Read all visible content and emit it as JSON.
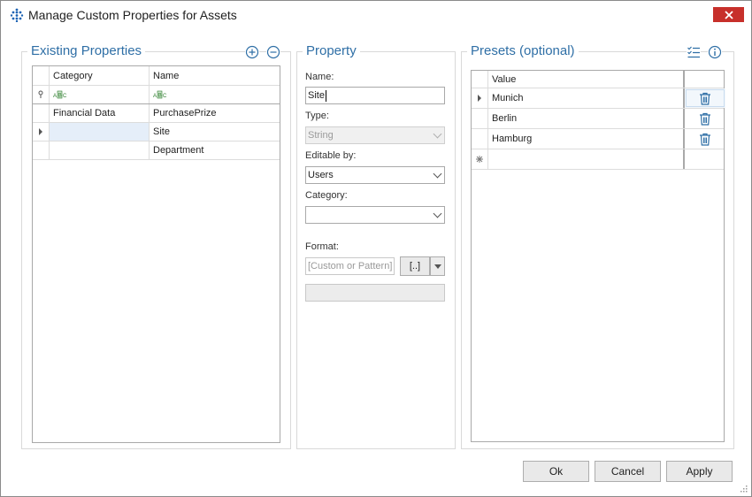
{
  "window": {
    "title": "Manage Custom Properties for Assets",
    "close_icon": "close-icon"
  },
  "existing_properties": {
    "title": "Existing Properties",
    "columns": [
      "Category",
      "Name"
    ],
    "rows": [
      {
        "category": "Financial Data",
        "name": "PurchasePrize"
      },
      {
        "category": "",
        "name": "Site"
      },
      {
        "category": "",
        "name": "Department"
      }
    ]
  },
  "property": {
    "title": "Property",
    "name_label": "Name:",
    "name_value": "Site",
    "type_label": "Type:",
    "type_value": "String",
    "editable_label": "Editable by:",
    "editable_value": "Users",
    "category_label": "Category:",
    "category_value": "",
    "format_label": "Format:",
    "format_placeholder": "[Custom or Pattern]",
    "format_button": "[..]",
    "preview_value": ""
  },
  "presets": {
    "title": "Presets (optional)",
    "column": "Value",
    "values": [
      "Munich",
      "Berlin",
      "Hamburg"
    ]
  },
  "buttons": {
    "ok": "Ok",
    "cancel": "Cancel",
    "apply": "Apply"
  },
  "colors": {
    "accent": "#2f6fa6",
    "close": "#c7302b",
    "selected_cell": "#e5eef9"
  }
}
